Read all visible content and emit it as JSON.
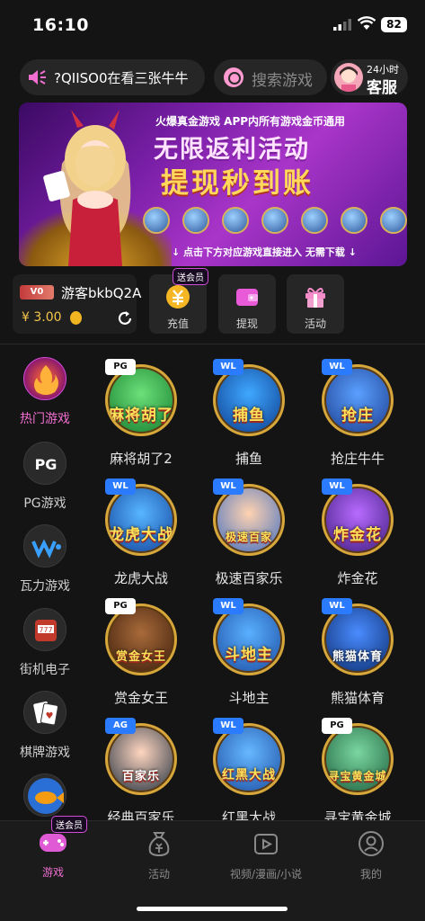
{
  "status": {
    "time": "16:10",
    "battery": "82"
  },
  "topbar": {
    "notice_text": "?QIISO0在看三张牛牛",
    "search_placeholder": "搜索游戏",
    "service_line1": "24小时",
    "service_line2": "客服"
  },
  "banner": {
    "line1": "火爆真金游戏  APP内所有游戏金币通用",
    "line2": "无限返利活动",
    "line3": "提现秒到账",
    "line4": "↓ 点击下方对应游戏直接进入 无需下载 ↓"
  },
  "account": {
    "vip_level": "V0",
    "username": "游客bkbQ2A",
    "balance": "¥ 3.00"
  },
  "quick_actions": [
    {
      "label": "充值",
      "icon": "yuan-icon",
      "tag": "送会员"
    },
    {
      "label": "提现",
      "icon": "wallet-icon"
    },
    {
      "label": "活动",
      "icon": "gift-icon"
    }
  ],
  "sidebar": [
    {
      "label": "热门游戏",
      "icon": "fire-icon",
      "active": true
    },
    {
      "label": "PG游戏",
      "icon": "pg-logo-icon"
    },
    {
      "label": "瓦力游戏",
      "icon": "wl-logo-icon"
    },
    {
      "label": "街机电子",
      "icon": "slot-machine-icon"
    },
    {
      "label": "棋牌游戏",
      "icon": "cards-icon"
    },
    {
      "label": "",
      "icon": "fish-icon"
    }
  ],
  "games": [
    {
      "label": "麻将胡了2",
      "badge": "PG",
      "art": "麻将胡了"
    },
    {
      "label": "捕鱼",
      "badge": "WL",
      "art": "捕鱼"
    },
    {
      "label": "抢庄牛牛",
      "badge": "WL",
      "art": "抢庄"
    },
    {
      "label": "龙虎大战",
      "badge": "WL",
      "art": "龙虎大战"
    },
    {
      "label": "极速百家乐",
      "badge": "WL",
      "art": "极速百家"
    },
    {
      "label": "炸金花",
      "badge": "WL",
      "art": "炸金花"
    },
    {
      "label": "赏金女王",
      "badge": "PG",
      "art": "赏金女王"
    },
    {
      "label": "斗地主",
      "badge": "WL",
      "art": "斗地主"
    },
    {
      "label": "熊猫体育",
      "badge": "WL",
      "art": "熊猫体育"
    },
    {
      "label": "经典百家乐",
      "badge": "AG",
      "art": "百家乐"
    },
    {
      "label": "红黑大战",
      "badge": "WL",
      "art": "红黑大战"
    },
    {
      "label": "寻宝黄金城",
      "badge": "PG",
      "art": "寻宝黄金城"
    }
  ],
  "bottom_nav": [
    {
      "label": "游戏",
      "icon": "gamepad-icon",
      "active": true,
      "tag": "送会员"
    },
    {
      "label": "活动",
      "icon": "money-bag-icon"
    },
    {
      "label": "视频/漫画/小说",
      "icon": "video-icon"
    },
    {
      "label": "我的",
      "icon": "user-icon"
    }
  ],
  "colors": {
    "accent": "#f06fd0",
    "gold": "#d8a73a",
    "bg": "#141414"
  }
}
